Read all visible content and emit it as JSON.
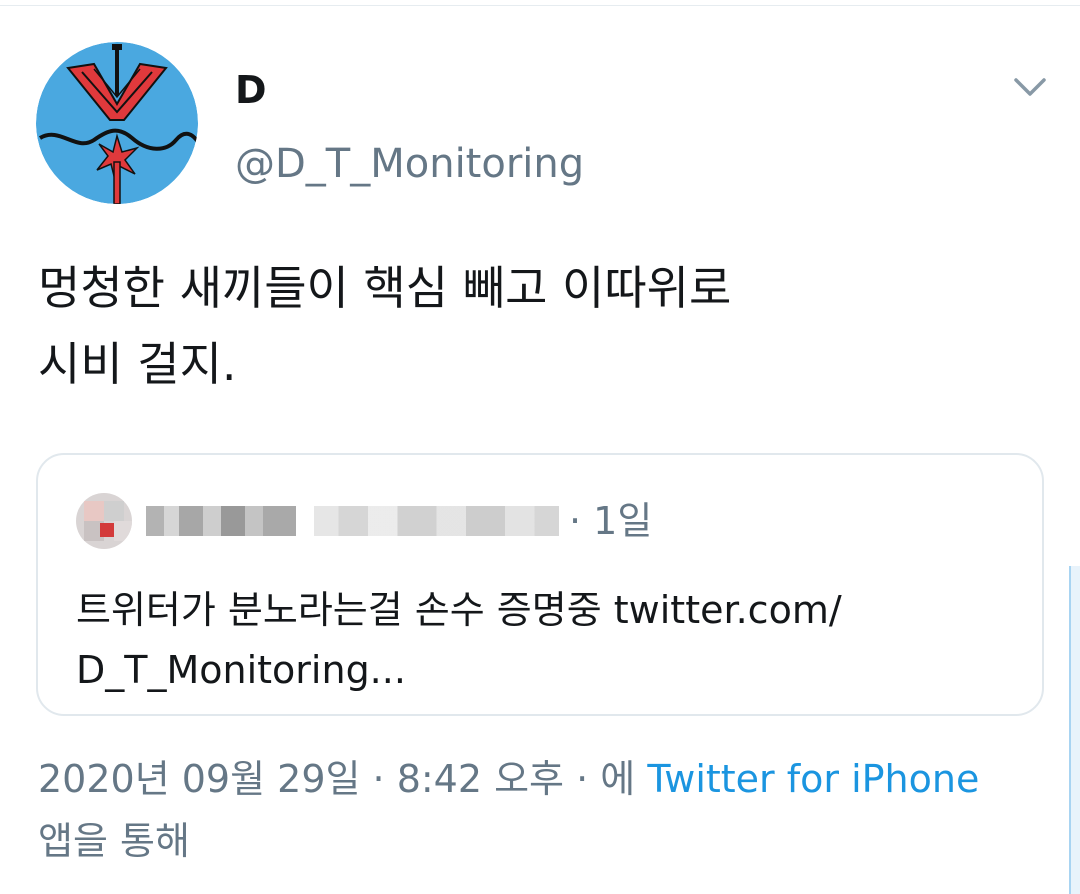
{
  "tweet": {
    "author_name": "D",
    "author_handle": "@D_T_Monitoring",
    "text_line1": "멍청한 새끼들이 핵심 빼고 이따위로",
    "text_line2": "시비 걸지.",
    "avatar_icon": "hexagram-candle-avatar",
    "menu_icon": "chevron-down-icon"
  },
  "quoted_tweet": {
    "time_ago": "· 1일",
    "text_line1": "트위터가 분노라는걸 손수 증명중 twitter.com/",
    "text_line2": "D_T_Monitoring..."
  },
  "meta": {
    "date_time": "2020년 09월 29일 · 8:42 오후 · 에 ",
    "source": "Twitter for iPhone",
    "suffix": "앱을 통해"
  },
  "colors": {
    "text_primary": "#14171a",
    "text_secondary": "#657786",
    "link": "#1b95e0",
    "border": "#e1e8ed",
    "avatar_bg": "#4aa8e0",
    "avatar_accent": "#e0393c"
  }
}
